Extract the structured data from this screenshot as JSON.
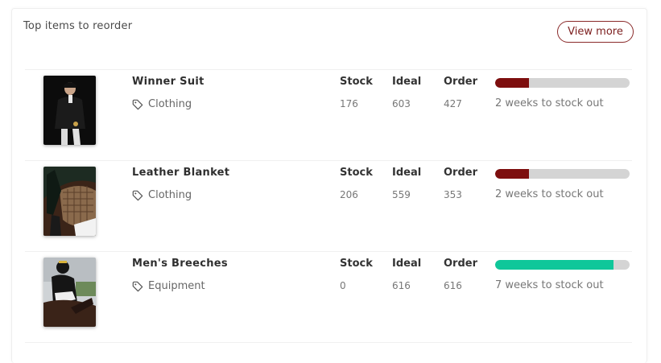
{
  "panel": {
    "title": "Top items to reorder",
    "view_more_label": "View more"
  },
  "columns": {
    "stock": "Stock",
    "ideal": "Ideal",
    "order": "Order"
  },
  "items": [
    {
      "name": "Winner Suit",
      "category": "Clothing",
      "stock": "176",
      "ideal": "603",
      "order": "427",
      "stock_out": "2 weeks to stock out",
      "progress_fraction": 0.25,
      "progress_color": "#7d0e0e"
    },
    {
      "name": "Leather Blanket",
      "category": "Clothing",
      "stock": "206",
      "ideal": "559",
      "order": "353",
      "stock_out": "2 weeks to stock out",
      "progress_fraction": 0.25,
      "progress_color": "#7d0e0e"
    },
    {
      "name": "Men's Breeches",
      "category": "Equipment",
      "stock": "0",
      "ideal": "616",
      "order": "616",
      "stock_out": "7 weeks to stock out",
      "progress_fraction": 0.88,
      "progress_color": "#0fc79a"
    }
  ],
  "icons": {
    "category": "tag-icon"
  }
}
